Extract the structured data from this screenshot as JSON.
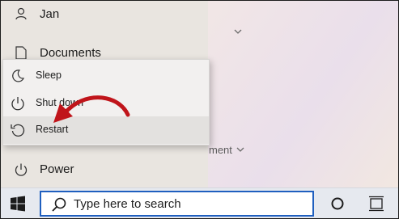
{
  "start_menu": {
    "user_name": "Jan",
    "documents_label": "Documents",
    "power_label": "Power",
    "background_fragment": "ment"
  },
  "power_menu": {
    "items": [
      {
        "label": "Sleep",
        "icon": "sleep-icon"
      },
      {
        "label": "Shut down",
        "icon": "shutdown-icon"
      },
      {
        "label": "Restart",
        "icon": "restart-icon"
      }
    ],
    "highlighted": "Restart"
  },
  "taskbar": {
    "search_placeholder": "Type here to search",
    "accent_color": "#1f5fbf"
  },
  "annotation": {
    "arrow_color": "#c0141a"
  }
}
